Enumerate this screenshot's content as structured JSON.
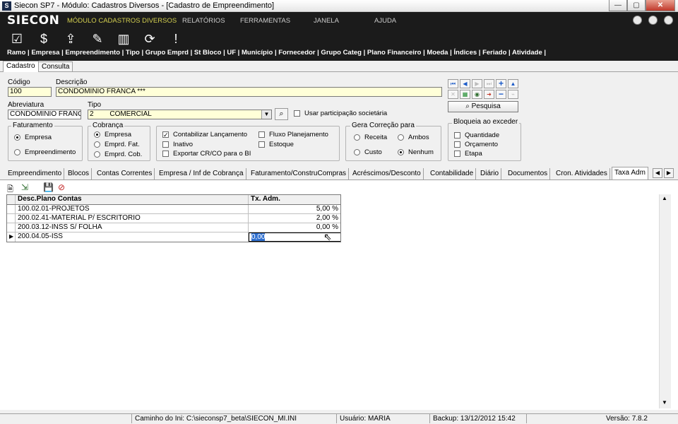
{
  "window": {
    "title": "Siecon SP7 - Módulo: Cadastros Diversos - [Cadastro de Empreendimento]",
    "min": "—",
    "max": "▢",
    "close": "✕"
  },
  "menu": {
    "logo": "SIECON",
    "items": [
      "MÓDULO CADASTROS DIVERSOS",
      "RELATÓRIOS",
      "FERRAMENTAS",
      "JANELA",
      "AJUDA"
    ]
  },
  "toolbar": {
    "icons": [
      "check-icon",
      "money-bag-icon",
      "export-icon",
      "edit-icon",
      "building-icon",
      "refresh-money-icon",
      "alert-icon"
    ]
  },
  "navbar": {
    "links": "Ramo | Empresa | Empreendimento | Tipo | Grupo Emprd | St Bloco | UF | Município | Fornecedor | Grupo Categ | Plano Financeiro | Moeda | Índices | Feriado | Atividade |"
  },
  "outer_tabs": [
    "Cadastro",
    "Consulta"
  ],
  "form": {
    "codigo_label": "Código",
    "codigo_value": "100",
    "descricao_label": "Descrição",
    "descricao_value": "CONDOMINIO FRANCA ***",
    "abreviatura_label": "Abreviatura",
    "abreviatura_value": "CONDOMINIO FRANC",
    "tipo_label": "Tipo",
    "tipo_code": "2",
    "tipo_value": "COMERCIAL",
    "usar_participacao": "Usar participação societária",
    "pesquisa": "Pesquisa"
  },
  "faturamento": {
    "title": "Faturamento",
    "options": [
      "Empresa",
      "Empreendimento"
    ]
  },
  "cobranca": {
    "title": "Cobrança",
    "options": [
      "Empresa",
      "Emprd. Fat.",
      "Emprd. Cob."
    ]
  },
  "checks": {
    "contabilizar": "Contabilizar Lançamento",
    "inativo": "Inativo",
    "exportar": "Exportar CR/CO para o BI",
    "fluxo": "Fluxo Planejamento",
    "estoque": "Estoque"
  },
  "gera_correcao": {
    "title": "Gera Correção para",
    "options": [
      "Receita",
      "Ambos",
      "Custo",
      "Nenhum"
    ]
  },
  "bloqueia": {
    "title": "Bloqueia ao exceder",
    "options": [
      "Quantidade",
      "Orçamento",
      "Etapa"
    ]
  },
  "sub_tabs": [
    "Empreendimento",
    "Blocos",
    "Contas Correntes",
    "Empresa / Inf de Cobrança",
    "Faturamento/ConstruCompras",
    "Acréscimos/Desconto",
    "Contabilidade",
    "Diário",
    "Documentos",
    "Cron. Atividades",
    "Taxa Adm"
  ],
  "grid": {
    "headers": [
      "Desc.Plano Contas",
      "Tx. Adm."
    ],
    "rows": [
      {
        "desc": "100.02.01-PROJETOS",
        "tx": "5,00 %"
      },
      {
        "desc": "200.02.41-MATERIAL P/ ESCRITORIO",
        "tx": "2,00 %"
      },
      {
        "desc": "200.03.12-INSS S/ FOLHA",
        "tx": "0,00 %"
      },
      {
        "desc": "200.04.05-ISS",
        "tx": "0,00"
      }
    ]
  },
  "status": {
    "caminho": "Caminho do Ini: C:\\sieconsp7_beta\\SIECON_MI.INI",
    "usuario": "Usuário: MARIA",
    "backup": "Backup: 13/12/2012 15:42",
    "versao": "Versão: 7.8.2"
  },
  "colors": {
    "menu_bg": "#1b1b1b",
    "active_menu": "#d4d050",
    "selection": "#3070d0",
    "field_yellow": "#ffffd8"
  }
}
